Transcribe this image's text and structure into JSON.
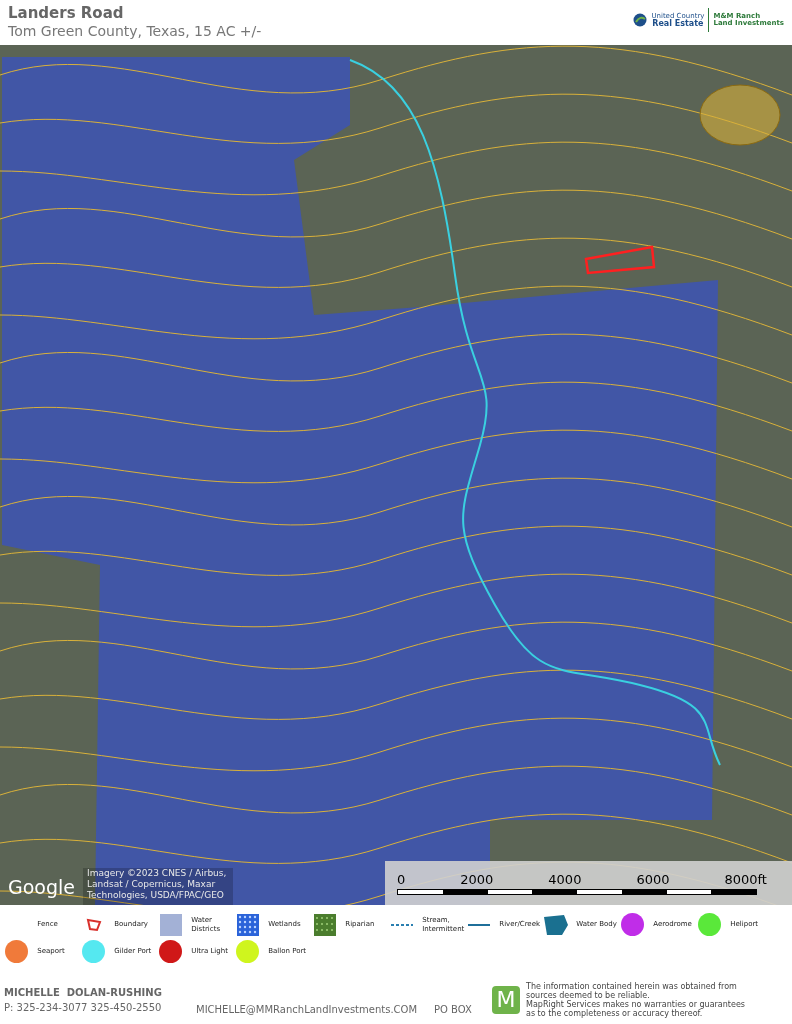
{
  "header": {
    "title": "Landers Road",
    "subtitle": "Tom Green County, Texas, 15 AC +/-",
    "logo": {
      "brand_top": "United Country",
      "brand_bottom": "Real Estate",
      "partner_top": "M&M Ranch",
      "partner_bottom": "Land Investments"
    }
  },
  "map": {
    "provider": "Google",
    "attribution": "Imagery ©2023 CNES / Airbus, Landsat / Copernicus, Maxar Technologies, USDA/FPAC/GEO",
    "scale": {
      "labels": [
        "0",
        "2000",
        "4000",
        "6000",
        "8000ft"
      ]
    }
  },
  "legend": [
    {
      "kind": "blank",
      "label": "Fence"
    },
    {
      "kind": "boundary",
      "label": "Boundary",
      "color": "#d9302c"
    },
    {
      "kind": "swatch",
      "label": "Water Districts",
      "color": "#a3b1d6"
    },
    {
      "kind": "wetlands",
      "label": "Wetlands",
      "color": "#2b63d9"
    },
    {
      "kind": "riparian",
      "label": "Riparian",
      "color": "#4b7d2e"
    },
    {
      "kind": "dashed",
      "label": "Stream, Intermittent",
      "color": "#2a7fb0"
    },
    {
      "kind": "line",
      "label": "River/Creek",
      "color": "#1f6f9a"
    },
    {
      "kind": "polygon",
      "label": "Water Body",
      "color": "#1a7090"
    },
    {
      "kind": "circle",
      "label": "Aerodrome",
      "color": "#c02de8"
    },
    {
      "kind": "circle",
      "label": "Heliport",
      "color": "#5ae83a"
    },
    {
      "kind": "circle",
      "label": "Seaport",
      "color": "#f07a3a"
    },
    {
      "kind": "circle",
      "label": "Gilder Port",
      "color": "#55e8f0"
    },
    {
      "kind": "circle",
      "label": "Ultra Light",
      "color": "#d01818"
    },
    {
      "kind": "circle",
      "label": "Ballon Port",
      "color": "#cff51e"
    }
  ],
  "footer": {
    "agent": "MICHELLE  DOLAN-RUSHING",
    "phone": "P: 325-234-3077 325-450-2550",
    "email": "MICHELLE@MMRanchLandInvestments.COM",
    "address": "PO BOX",
    "badge": "M",
    "disclaimer": "The information contained herein was obtained from sources deemed to be reliable.\n  MapRight Services makes no warranties or guarantees as to the completeness or accuracy thereof."
  }
}
